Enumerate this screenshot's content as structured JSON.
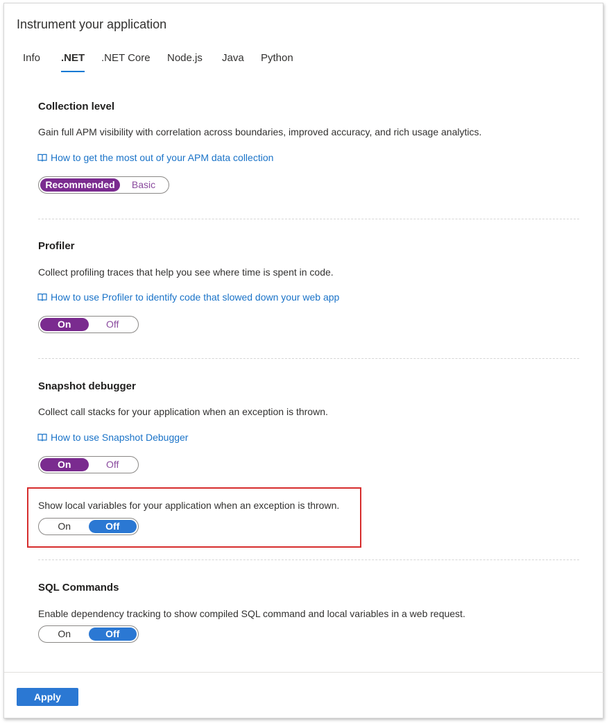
{
  "title": "Instrument your application",
  "tabs": [
    {
      "label": "Info"
    },
    {
      "label": ".NET"
    },
    {
      "label": ".NET Core"
    },
    {
      "label": "Node.js"
    },
    {
      "label": "Java"
    },
    {
      "label": "Python"
    }
  ],
  "active_tab": ".NET",
  "sections": {
    "collection": {
      "title": "Collection level",
      "description": "Gain full APM visibility with correlation across boundaries, improved accuracy, and rich usage analytics.",
      "link": "How to get the most out of your APM data collection",
      "toggle": {
        "option1": "Recommended",
        "option2": "Basic",
        "selected": "Recommended"
      }
    },
    "profiler": {
      "title": "Profiler",
      "description": "Collect profiling traces that help you see where time is spent in code.",
      "link": "How to use Profiler to identify code that slowed down your web app",
      "toggle": {
        "option1": "On",
        "option2": "Off",
        "selected": "On"
      }
    },
    "snapshot": {
      "title": "Snapshot debugger",
      "description": "Collect call stacks for your application when an exception is thrown.",
      "link": "How to use Snapshot Debugger",
      "toggle": {
        "option1": "On",
        "option2": "Off",
        "selected": "On"
      },
      "local_vars": {
        "description": "Show local variables for your application when an exception is thrown.",
        "toggle": {
          "option1": "On",
          "option2": "Off",
          "selected": "Off"
        }
      }
    },
    "sql": {
      "title": "SQL Commands",
      "description": "Enable dependency tracking to show compiled SQL command and local variables in a web request.",
      "toggle": {
        "option1": "On",
        "option2": "Off",
        "selected": "Off"
      }
    }
  },
  "apply_label": "Apply",
  "colors": {
    "accent_purple": "#7a2b8f",
    "accent_blue": "#2b78d3",
    "link_blue": "#1a73c8",
    "highlight_red": "#d62d2d"
  },
  "icons": {
    "link_icon": "book-icon"
  }
}
